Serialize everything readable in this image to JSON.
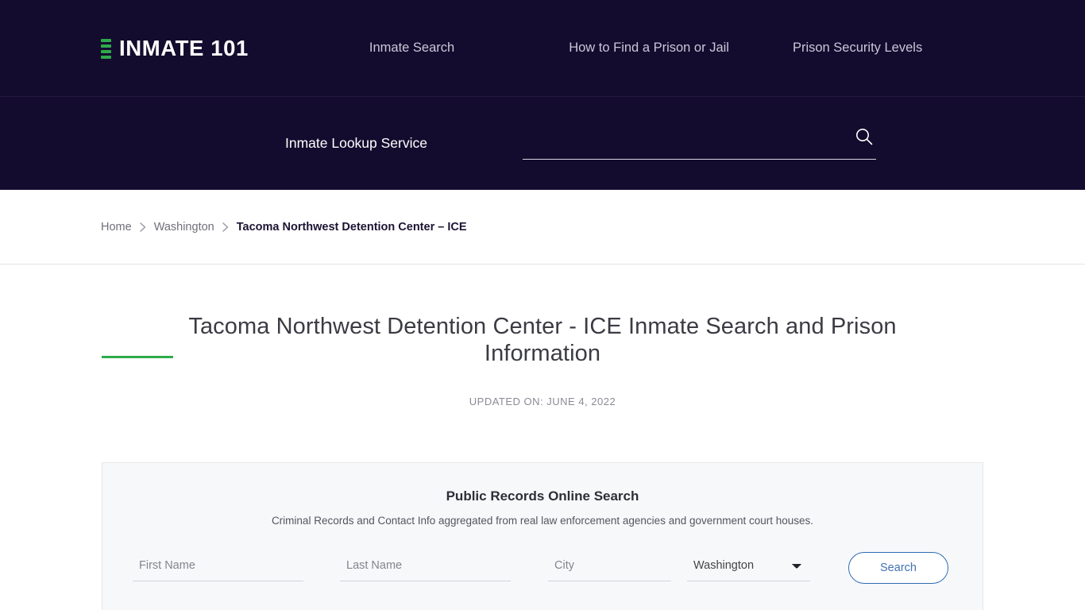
{
  "header": {
    "logo_text": "INMATE 101",
    "logo_icon": "stacked-bars-icon",
    "nav": [
      {
        "label": "Inmate Search"
      },
      {
        "label": "How to Find a Prison or Jail"
      },
      {
        "label": "Prison Security Levels"
      }
    ]
  },
  "site_search": {
    "label": "Inmate Lookup Service",
    "value": "",
    "placeholder": "",
    "icon": "search-icon"
  },
  "breadcrumb": {
    "items": [
      {
        "label": "Home"
      },
      {
        "label": "Washington"
      },
      {
        "label": "Tacoma Northwest Detention Center – ICE"
      }
    ],
    "separator_icon": "chevron-right-icon"
  },
  "page": {
    "title": "Tacoma Northwest Detention Center - ICE Inmate Search and Prison Information",
    "updated_on": "UPDATED ON: JUNE 4, 2022",
    "accent_color": "#2eab4a"
  },
  "records_form": {
    "title": "Public Records Online Search",
    "subtitle": "Criminal Records and Contact Info aggregated from real law enforcement agencies and government court houses.",
    "first_name": {
      "value": "",
      "placeholder": "First Name"
    },
    "last_name": {
      "value": "",
      "placeholder": "Last Name"
    },
    "city": {
      "value": "",
      "placeholder": "City"
    },
    "state": {
      "selected": "Washington",
      "options": [
        "Washington"
      ]
    },
    "submit_label": "Search",
    "submit_color": "#2f6cb5"
  }
}
